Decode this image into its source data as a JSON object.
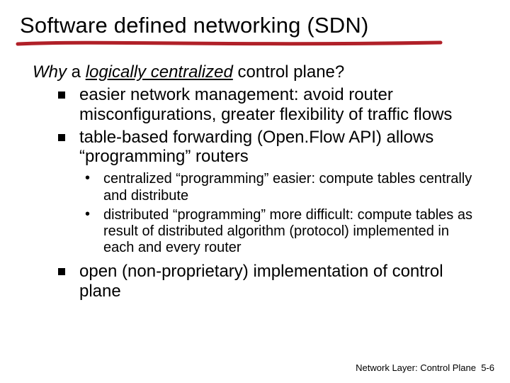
{
  "title": "Software defined networking (SDN)",
  "intro": {
    "why": "Why",
    "mid1": " a ",
    "lc": "logically centralized",
    "tail": " control plane?"
  },
  "bullets": {
    "b1": "easier network management: avoid router misconfigurations, greater flexibility of traffic flows",
    "b2": "table-based forwarding (Open.Flow API) allows “programming” routers",
    "sub1": "centralized “programming” easier: compute tables centrally and distribute",
    "sub2": "distributed “programming” more difficult: compute tables as result of distributed algorithm (protocol) implemented in each and every router",
    "b3": "open (non-proprietary) implementation of control plane"
  },
  "footer": {
    "section": "Network Layer: Control Plane",
    "page": "5-6"
  }
}
